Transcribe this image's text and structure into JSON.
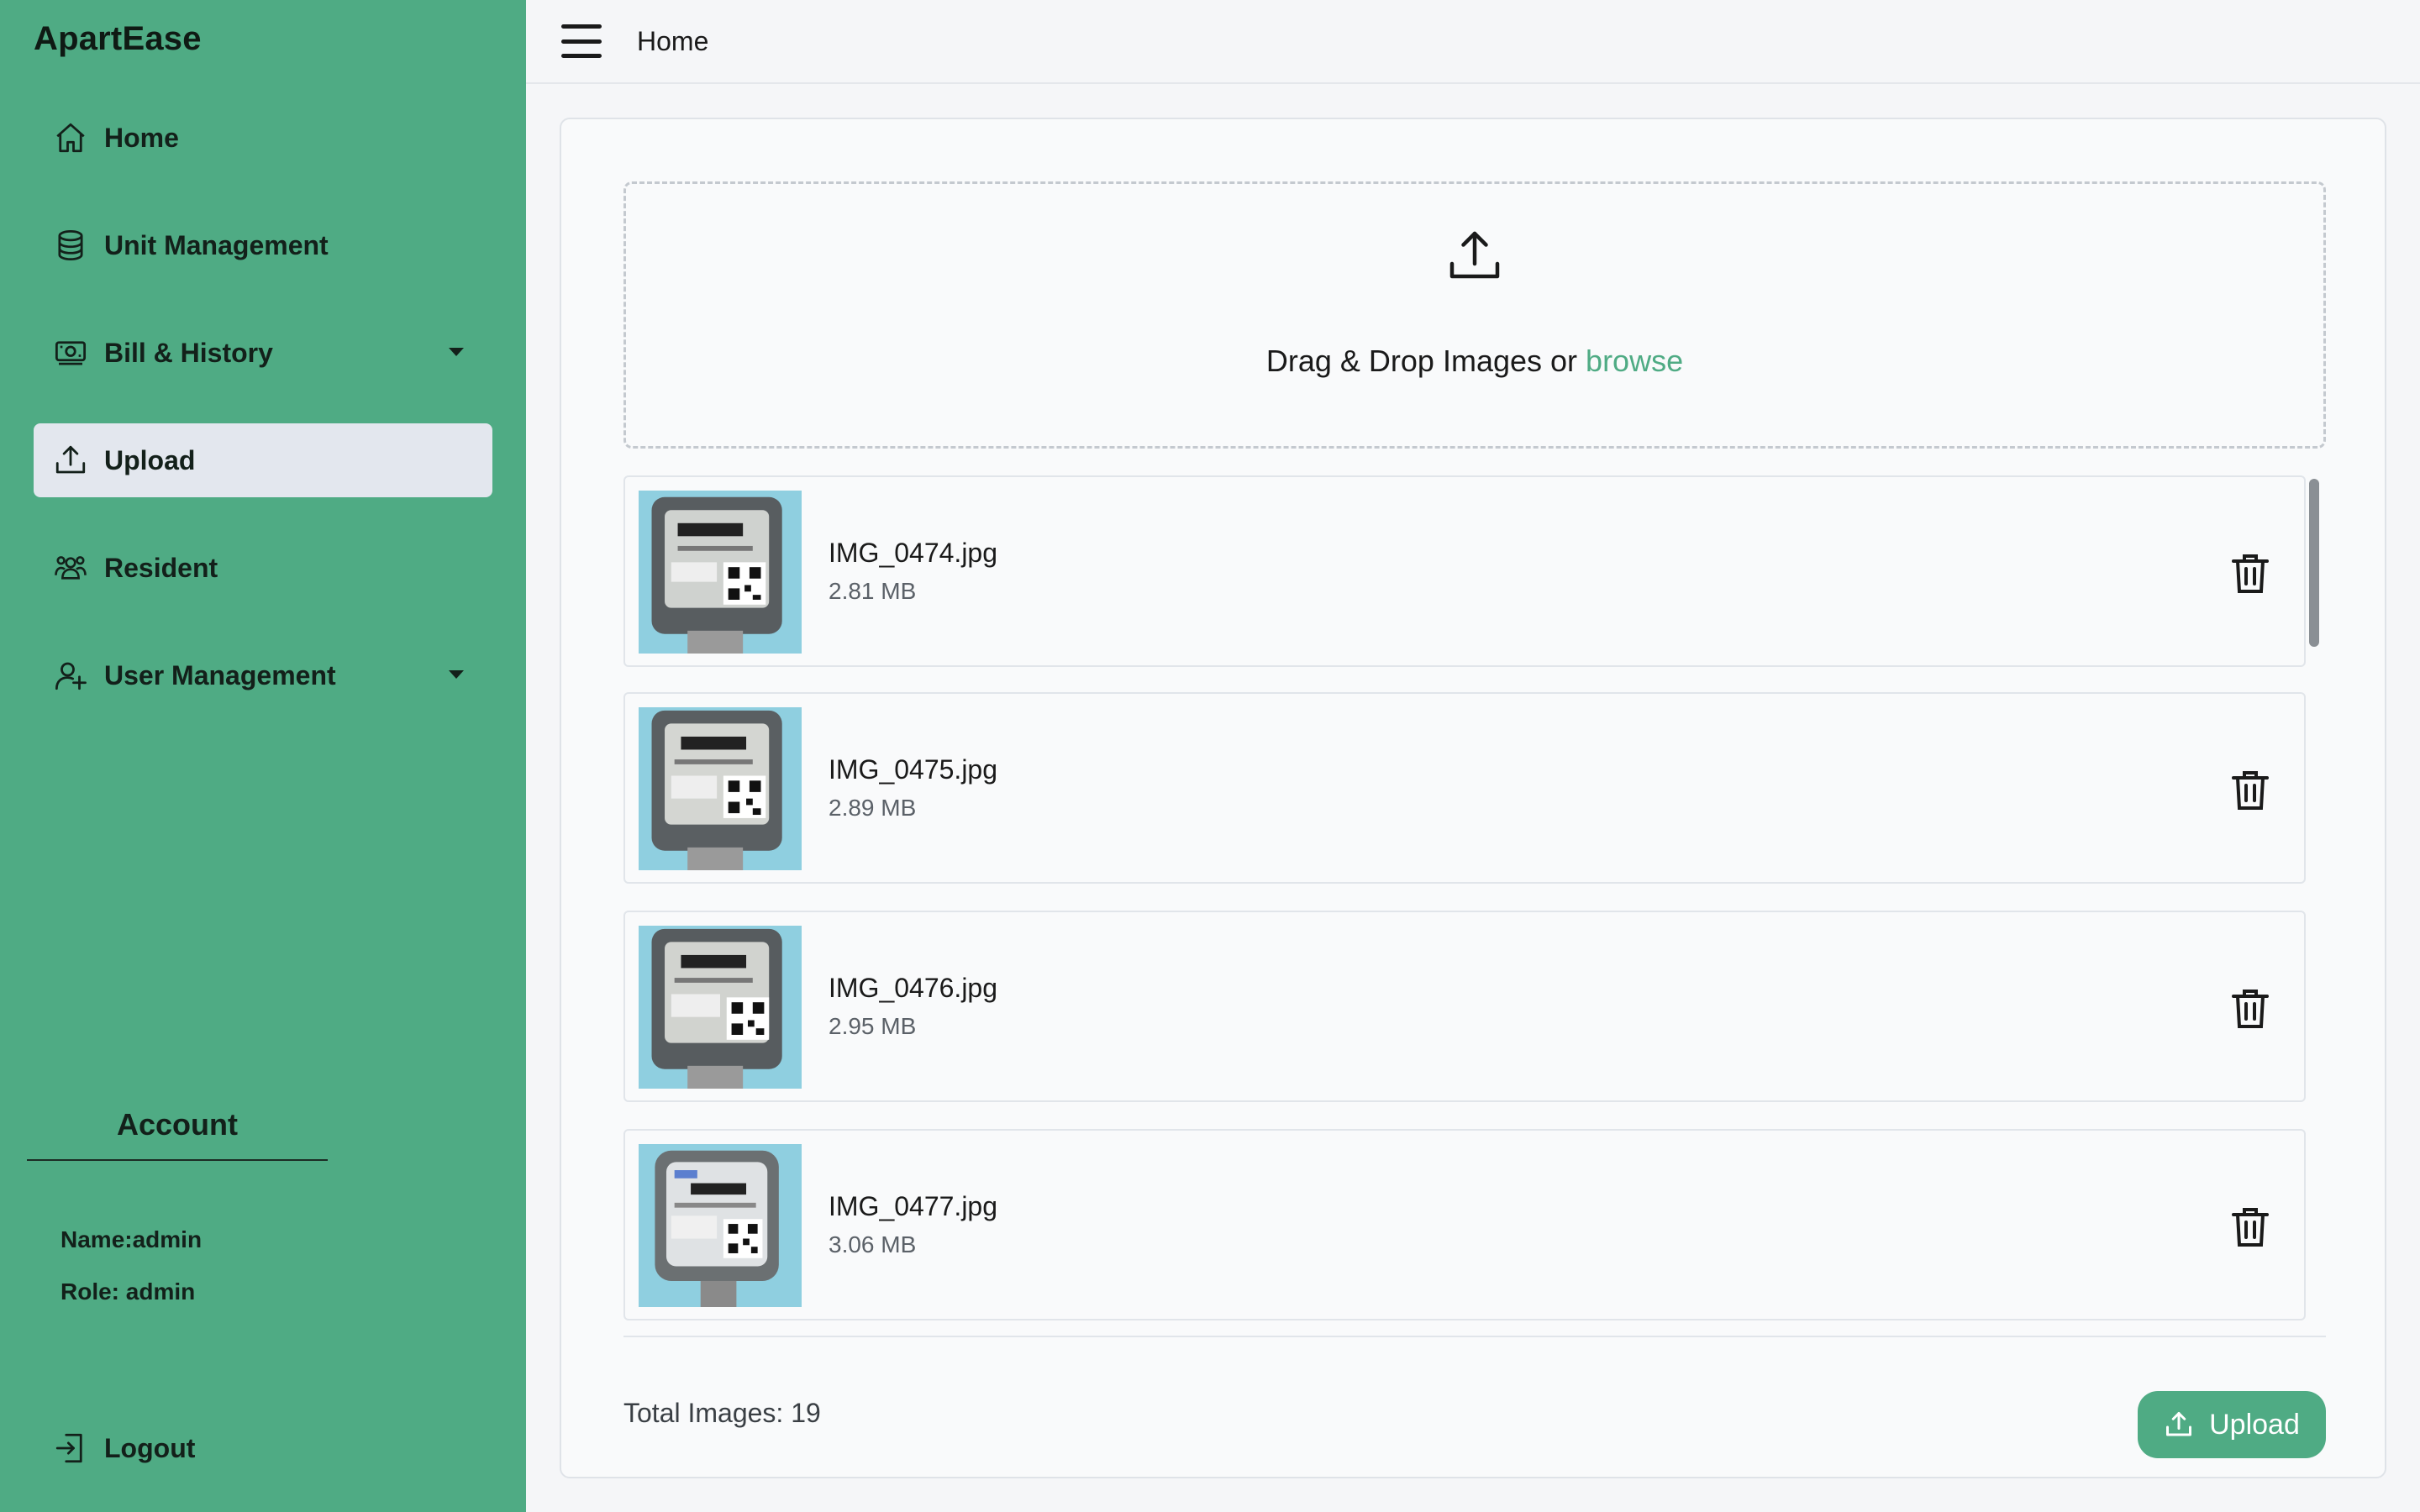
{
  "app": {
    "brand": "ApartEase"
  },
  "sidebar": {
    "items": [
      {
        "label": "Home",
        "icon": "home-icon"
      },
      {
        "label": "Unit Management",
        "icon": "database-icon"
      },
      {
        "label": "Bill & History",
        "icon": "money-icon",
        "has_dropdown": true
      },
      {
        "label": "Upload",
        "icon": "upload-icon",
        "active": true
      },
      {
        "label": "Resident",
        "icon": "users-icon"
      },
      {
        "label": "User Management",
        "icon": "user-add-icon",
        "has_dropdown": true
      }
    ],
    "account": {
      "title": "Account",
      "name_line": "Name:admin",
      "role_line": "Role: admin"
    },
    "logout_label": "Logout"
  },
  "topbar": {
    "title": "Home"
  },
  "dropzone": {
    "text": "Drag & Drop Images or",
    "browse_label": "browse"
  },
  "files": [
    {
      "name": "IMG_0474.jpg",
      "size": "2.81 MB"
    },
    {
      "name": "IMG_0475.jpg",
      "size": "2.89 MB"
    },
    {
      "name": "IMG_0476.jpg",
      "size": "2.95 MB"
    },
    {
      "name": "IMG_0477.jpg",
      "size": "3.06 MB"
    }
  ],
  "footer": {
    "total_label": "Total Images: 19",
    "upload_button": "Upload"
  },
  "colors": {
    "brand_green": "#4fab84",
    "active_item_bg": "#e3e7ee",
    "page_bg": "#f5f6f8"
  }
}
